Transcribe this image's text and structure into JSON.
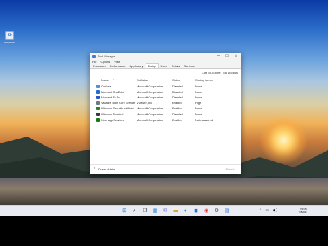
{
  "desktop": {
    "recycle_bin_label": "Recycle Bin"
  },
  "window": {
    "title": "Task Manager",
    "controls": {
      "minimize": "—",
      "maximize": "☐",
      "close": "✕"
    },
    "menu": [
      "File",
      "Options",
      "View"
    ],
    "tabs": [
      "Processes",
      "Performance",
      "App history",
      "Startup",
      "Users",
      "Details",
      "Services"
    ],
    "active_tab": "Startup",
    "bios_label": "Last BIOS time:",
    "bios_value": "3.8 seconds",
    "columns": {
      "name": "Name",
      "publisher": "Publisher",
      "status": "Status",
      "impact": "Startup impact"
    },
    "rows": [
      {
        "name": "Cortana",
        "publisher": "Microsoft Corporation",
        "status": "Disabled",
        "impact": "None",
        "icon_color": "#5a8fd8"
      },
      {
        "name": "Microsoft OneDrive",
        "publisher": "Microsoft Corporation",
        "status": "Disabled",
        "impact": "None",
        "icon_color": "#1f6fd1"
      },
      {
        "name": "Microsoft To Do",
        "publisher": "Microsoft Corporation",
        "status": "Disabled",
        "impact": "None",
        "icon_color": "#2a56c6"
      },
      {
        "name": "VMware Tools Core Service",
        "publisher": "VMware, Inc.",
        "status": "Enabled",
        "impact": "High",
        "icon_color": "#6c7a89"
      },
      {
        "name": "Windows Security notificati...",
        "publisher": "Microsoft Corporation",
        "status": "Enabled",
        "impact": "None",
        "icon_color": "#2e7d32"
      },
      {
        "name": "Windows Terminal",
        "publisher": "Microsoft Corporation",
        "status": "Disabled",
        "impact": "None",
        "icon_color": "#3a3a3a"
      },
      {
        "name": "Xbox App Services",
        "publisher": "Microsoft Corporation",
        "status": "Enabled",
        "impact": "Not measured",
        "icon_color": "#107c10"
      }
    ],
    "fewer_details": "Fewer details",
    "disable_button": "Disable"
  },
  "taskbar": {
    "time": "7:52 PM",
    "date": "7/18/2021",
    "icons": [
      "windows-start",
      "search",
      "task-view",
      "widgets",
      "chat",
      "file-explorer",
      "edge",
      "store",
      "chrome",
      "settings",
      "task-manager"
    ]
  }
}
